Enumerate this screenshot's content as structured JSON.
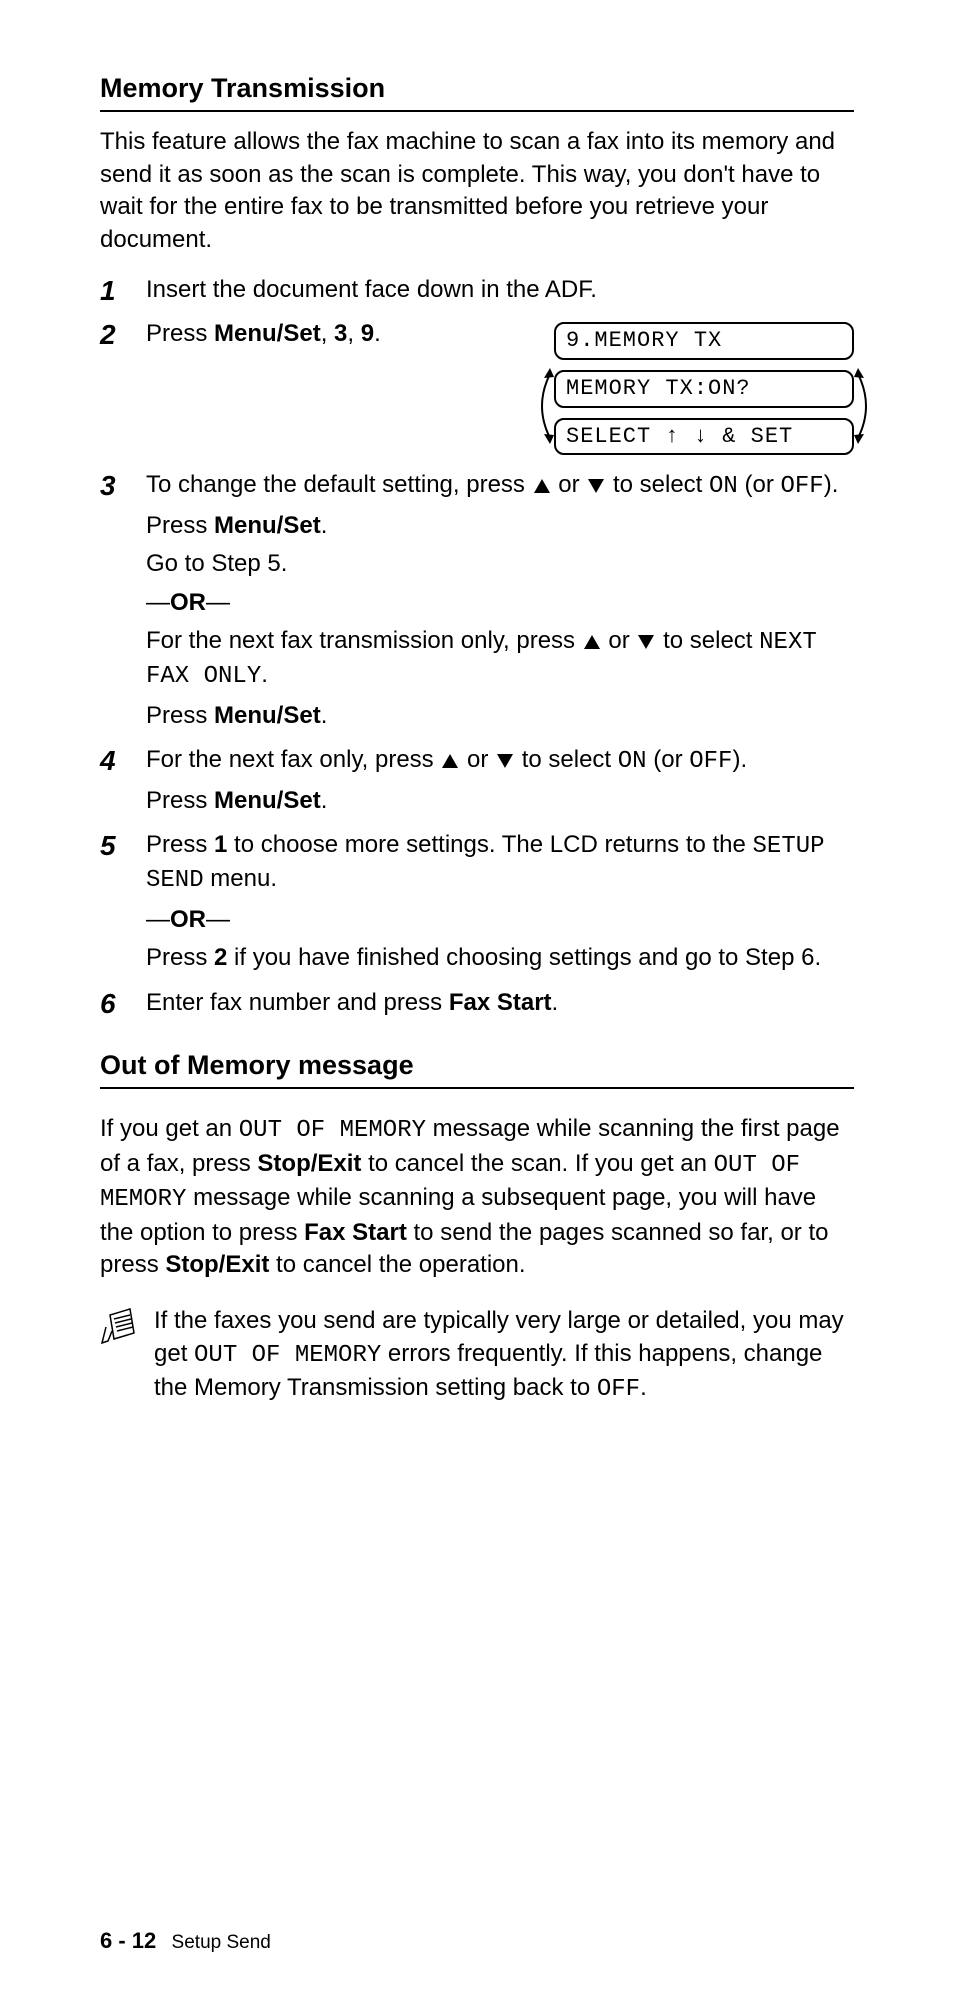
{
  "section1": {
    "title": "Memory Transmission",
    "intro": "This feature allows the fax machine to scan a fax into its memory and send it as soon as the scan is complete. This way, you don't have to wait for the entire fax to be transmitted before you retrieve your document.",
    "steps": {
      "n1": "1",
      "s1_a": "Insert the document face down in the ADF.",
      "n2": "2",
      "s2_a": "Press ",
      "s2_b": "Menu/Set",
      "s2_c": ", ",
      "s2_d": "3",
      "s2_e": ", ",
      "s2_f": "9",
      "s2_g": ".",
      "n3": "3",
      "s3_a": "To change the default setting, press ",
      "s3_b": " or ",
      "s3_c": " to select ",
      "s3_on": "ON",
      "s3_d": " (or ",
      "s3_off": "OFF",
      "s3_e": ").",
      "s3_press": "Press ",
      "s3_menu": "Menu/Set",
      "s3_dot": ".",
      "s3_go": "Go to Step 5.",
      "s3_or1": "—",
      "s3_or2": "OR",
      "s3_or3": "—",
      "s3_f": "For the next fax transmission only, press ",
      "s3_g": " or ",
      "s3_h": " to select ",
      "s3_next": "NEXT FAX ONLY",
      "s3_i": ".",
      "s3_press2": "Press ",
      "s3_menu2": "Menu/Set",
      "s3_dot2": ".",
      "n4": "4",
      "s4_a": "For the next fax only, press ",
      "s4_b": " or ",
      "s4_c": " to select ",
      "s4_on": "ON",
      "s4_d": " (or ",
      "s4_off": "OFF",
      "s4_e": ").",
      "s4_press": "Press ",
      "s4_menu": "Menu/Set",
      "s4_dot": ".",
      "n5": "5",
      "s5_a": "Press ",
      "s5_1": "1",
      "s5_b": " to choose more settings. The LCD returns to the ",
      "s5_setup": "SETUP SEND",
      "s5_c": " menu.",
      "s5_or1": "—",
      "s5_or2": "OR",
      "s5_or3": "—",
      "s5_d": "Press ",
      "s5_2": "2",
      "s5_e": " if you have finished choosing settings and go to Step 6.",
      "n6": "6",
      "s6_a": "Enter fax number and press ",
      "s6_fax": "Fax Start",
      "s6_b": "."
    },
    "lcd": {
      "l1": "9.MEMORY TX",
      "l2": "MEMORY TX:ON?",
      "l3": "SELECT ↑ ↓ & SET"
    }
  },
  "section2": {
    "title": "Out of Memory message",
    "p1_a": "If you get an ",
    "p1_mono1": "OUT OF MEMORY",
    "p1_b": " message while scanning the first page of a fax, press ",
    "p1_stop1": "Stop/Exit",
    "p1_c": " to cancel the scan. If you get an ",
    "p1_mono2": "OUT OF MEMORY",
    "p1_d": " message while scanning a subsequent page, you will have the option to press ",
    "p1_fax": "Fax Start",
    "p1_e": " to send the pages scanned so far, or to press ",
    "p1_stop2": "Stop/Exit",
    "p1_f": " to cancel the operation.",
    "note_a": "If the faxes you send are typically very large or detailed, you may get ",
    "note_mono": "OUT OF MEMORY",
    "note_b": " errors frequently. If this happens, change the Memory Transmission setting back to ",
    "note_off": "OFF",
    "note_c": "."
  },
  "footer": {
    "page": "6 - 12",
    "section": "Setup Send"
  }
}
